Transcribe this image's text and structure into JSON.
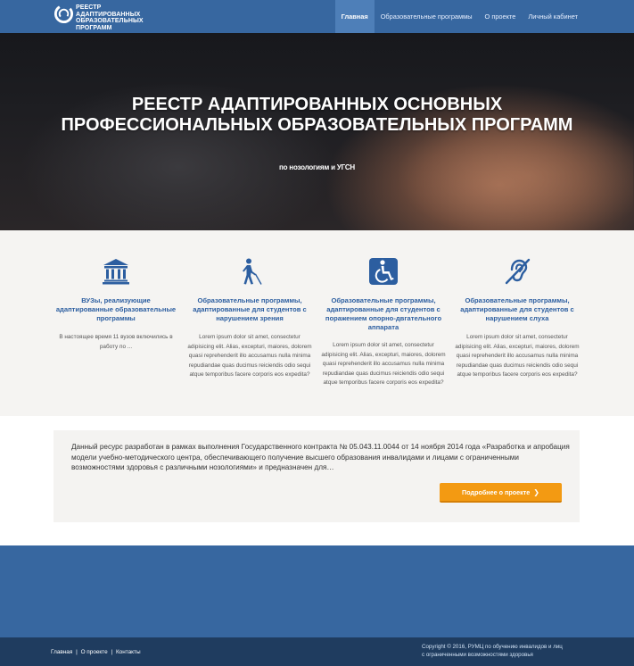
{
  "header": {
    "logo_lines": [
      "РЕЕСТР",
      "АДАПТИРОВАННЫХ",
      "ОБРАЗОВАТЕЛЬНЫХ",
      "ПРОГРАММ"
    ],
    "nav": [
      {
        "label": "Главная",
        "active": true
      },
      {
        "label": "Образовательные программы",
        "active": false
      },
      {
        "label": "О проекте",
        "active": false
      },
      {
        "label": "Личный кабинет",
        "active": false
      }
    ]
  },
  "hero": {
    "title": "РЕЕСТР АДАПТИРОВАННЫХ ОСНОВНЫХ ПРОФЕССИОНАЛЬНЫХ ОБРАЗОВАТЕЛЬНЫХ ПРОГРАММ",
    "subtitle": "по нозологиям и УГСН"
  },
  "features": [
    {
      "icon": "university-icon",
      "title": "ВУЗы, реализующие адаптированные образовательные программы",
      "text": "В настоящее время 11 вузов включились в работу по ..."
    },
    {
      "icon": "blind-person-icon",
      "title": "Образовательные программы, адаптированные для студентов с нарушением зрения",
      "text": "Lorem ipsum dolor sit amet, consectetur adipisicing elit. Alias, excepturi, maiores, dolorem quasi reprehenderit illo accusamus nulla minima repudiandae quas ducimus reiciendis odio sequi atque temporibus facere corporis eos expedita?"
    },
    {
      "icon": "wheelchair-icon",
      "title": "Образовательные программы, адаптированные для студентов с поражением опорно-двгательного аппарата",
      "text": "Lorem ipsum dolor sit amet, consectetur adipisicing elit. Alias, excepturi, maiores, dolorem quasi reprehenderit illo accusamus nulla minima repudiandae quas ducimus reiciendis odio sequi atque temporibus facere corporis eos expedita?"
    },
    {
      "icon": "hearing-impaired-icon",
      "title": "Образовательные программы, адаптированные для студентов с нарушением слуха",
      "text": "Lorem ipsum dolor sit amet, consectetur adipisicing elit. Alias, excepturi, maiores, dolorem quasi reprehenderit illo accusamus nulla minima repudiandae quas ducimus reiciendis odio sequi atque temporibus facere corporis eos expedita?"
    }
  ],
  "about": {
    "text": "Данный ресурс разработан в рамках выполнения Государственного контракта № 05.043.11.0044 от 14 ноября 2014 года «Разработка и апробация модели учебно-методического центра, обеспечивающего получение высшего образования инвалидами и лицами с ограниченными возможностями здоровья с различными нозологиями» и предназначен для…",
    "button_label": "Подробнее о проекте",
    "button_arrow": "❯"
  },
  "footer": {
    "links": [
      "Главная",
      "О проекте",
      "Контакты"
    ],
    "separator": "|",
    "copyright_line1": "Copyright © 2016, РУМЦ по обучению инвалидов и лиц",
    "copyright_line2": "с ограниченными возможностями здоровья"
  },
  "colors": {
    "nav_bg": "#3767a0",
    "nav_active_bg": "#4e7fb8",
    "feature_title": "#2c5ea0",
    "button": "#f39a12",
    "footer_bottom": "#1f3c5f"
  }
}
